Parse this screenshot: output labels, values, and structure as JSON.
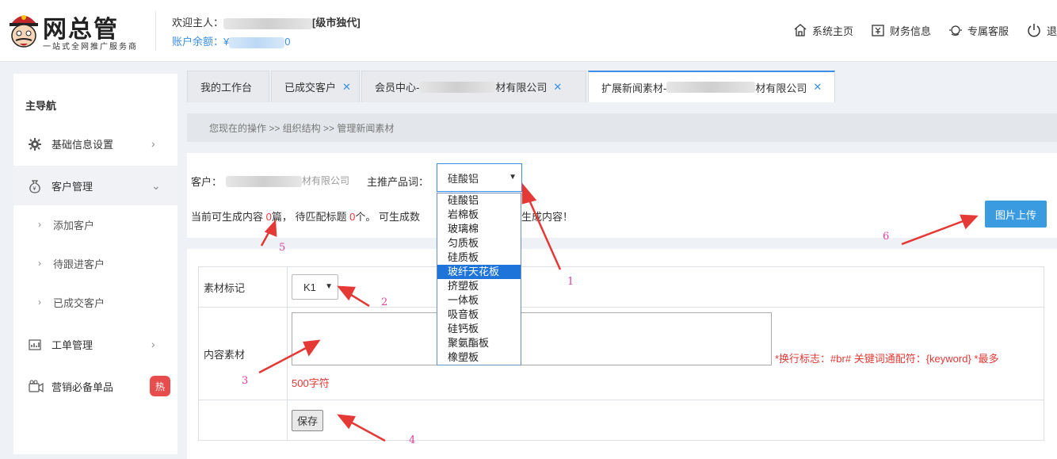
{
  "header": {
    "logo_title": "网总管",
    "logo_subtitle": "一站式全网推广服务商",
    "welcome_prefix": "欢迎主人：",
    "welcome_suffix": "[级市独代]",
    "balance_prefix": "账户余额：¥",
    "balance_suffix": "0",
    "nav": [
      {
        "label": "系统主页",
        "icon": "home-icon"
      },
      {
        "label": "财务信息",
        "icon": "finance-icon"
      },
      {
        "label": "专属客服",
        "icon": "service-icon"
      },
      {
        "label": "退",
        "icon": "power-icon"
      }
    ]
  },
  "sidebar": {
    "title": "主导航",
    "items": [
      {
        "label": "基础信息设置",
        "icon": "gear-icon"
      },
      {
        "label": "客户管理",
        "icon": "money-bag-icon"
      },
      {
        "label": "工单管理",
        "icon": "chart-icon"
      },
      {
        "label": "营销必备单品",
        "icon": "camera-icon",
        "badge": "热"
      }
    ],
    "sub_items": [
      "添加客户",
      "待跟进客户",
      "已成交客户"
    ]
  },
  "tabs": [
    {
      "label": "我的工作台",
      "closable": false
    },
    {
      "label": "已成交客户",
      "closable": true
    },
    {
      "label_prefix": "会员中心-",
      "label_suffix": "材有限公司",
      "closable": true
    },
    {
      "label_prefix": "扩展新闻素材-",
      "label_suffix": "材有限公司",
      "closable": true,
      "active": true
    }
  ],
  "breadcrumb": "您现在的操作 >> 组织结构 >> 管理新闻素材",
  "info": {
    "customer_label": "客户：",
    "customer_suffix": "材有限公司",
    "product_label": "主推产品词：",
    "product_selected": "硅酸铝",
    "gen_line": {
      "p1": "当前可生成内容 ",
      "count1": "0",
      "p2": "篇， 待匹配标题 ",
      "count2": "0",
      "p3": "个。 可生成数",
      "p4": "可生成内容！"
    },
    "upload_button": "图片上传"
  },
  "product_options": [
    "硅酸铝",
    "岩棉板",
    "玻璃棉",
    "匀质板",
    "硅质板",
    "玻纤天花板",
    "挤塑板",
    "一体板",
    "吸音板",
    "硅钙板",
    "聚氨酯板",
    "橡塑板"
  ],
  "product_highlighted_index": 5,
  "form": {
    "material_label": "素材标记",
    "material_value": "K1",
    "content_label": "内容素材",
    "content_value": "",
    "hint_line1": "*换行标志：#br# 关键词通配符：{keyword} *最多",
    "hint_line2": "500字符",
    "save_button": "保存"
  },
  "annotations": [
    "1",
    "2",
    "3",
    "4",
    "5",
    "6"
  ],
  "colors": {
    "accent": "#3a8ee6",
    "annotation": "#e040a0",
    "hint": "#e53935"
  }
}
